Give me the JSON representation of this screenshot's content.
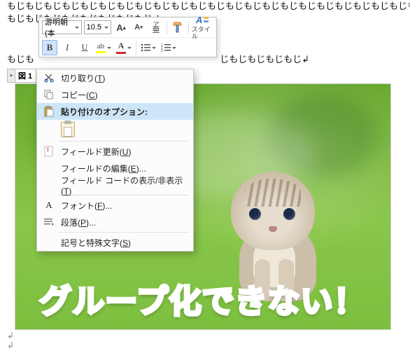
{
  "doc": {
    "line_fragment_top": "もじもじもじもじもじもじもじもじもじもじもじもじもじもじもじもじもじもじもじもじもじもじもじもじもじもじもじもじもじもじ",
    "line2": "もじもじもじもじもじもじもじもじ↲",
    "line3_left": "もじも",
    "line3_right": "じもじもじもじもじ↲",
    "caption": "図 1",
    "overlay_text": "グループ化できない！"
  },
  "toolbar": {
    "font_name": "游明朝 (本",
    "font_size": "10.5",
    "btn_increase": "A",
    "btn_decrease": "A",
    "btn_ruby_top": "ア",
    "btn_ruby_bottom": "亜",
    "btn_format_painter": "✔",
    "btn_bold": "B",
    "btn_italic": "I",
    "btn_underline": "U",
    "style_label": "スタイル"
  },
  "ctx": {
    "cut": "切り取り(T)",
    "copy": "コピー(C)",
    "paste_header": "貼り付けのオプション:",
    "update_field": "フィールド更新(U)",
    "edit_field": "フィールドの編集(E)...",
    "toggle_codes": "フィールド コードの表示/非表示(T)",
    "font": "フォント(F)...",
    "paragraph": "段落(P)...",
    "symbols": "記号と特殊文字(S)"
  }
}
